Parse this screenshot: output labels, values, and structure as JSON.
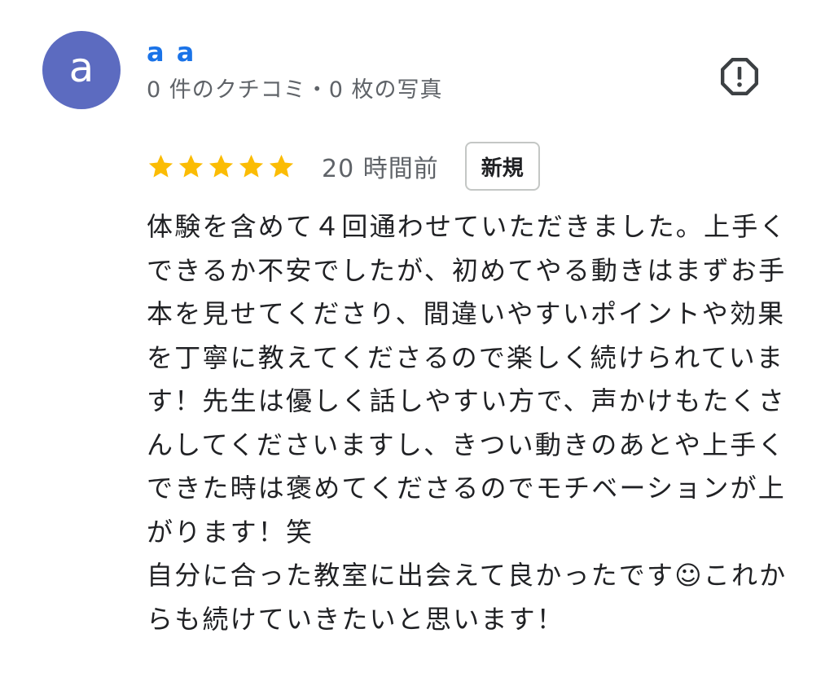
{
  "reviewer": {
    "avatar_letter": "a",
    "avatar_color": "#5c6bc0",
    "name": "a a",
    "meta": "0 件のクチコミ・0 枚の写真"
  },
  "review": {
    "rating": 5,
    "max_rating": 5,
    "star_color": "#fbbc04",
    "time": "20 時間前",
    "badge": "新規",
    "text": "体験を含めて４回通わせていただきました。上手くできるか不安でしたが、初めてやる動きはまずお手本を見せてくださり、間違いやすいポイントや効果を丁寧に教えてくださるので楽しく続けられています！先生は優しく話しやすい方で、声かけもたくさんしてくださいますし、きつい動きのあとや上手くできた時は褒めてくださるのでモチベーションが上がります！笑\n自分に合った教室に出会えて良かったです☺これからも続けていきたいと思います！"
  },
  "icons": {
    "report": "report-flag-octagon-icon",
    "star": "star-icon"
  }
}
